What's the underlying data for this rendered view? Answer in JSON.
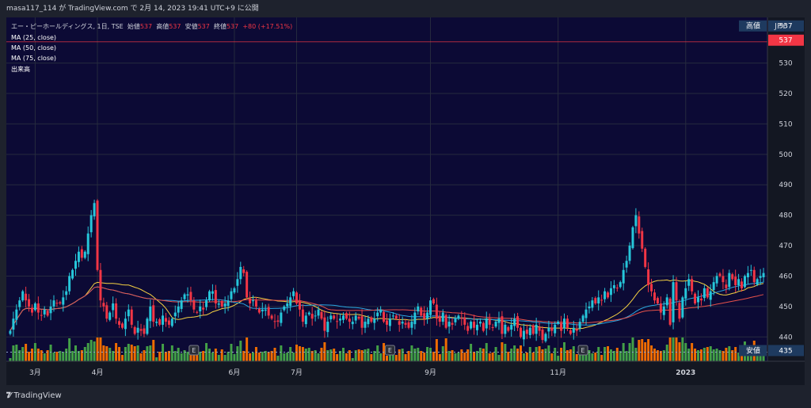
{
  "header": {
    "caption": "masa117_114 が TradingView.com で 2月 14, 2023 19:41 UTC+9 に公開"
  },
  "legend": {
    "symbol": "エー・ピーホールディングス, 1日, TSE",
    "open_label": "始値",
    "open_value": "537",
    "high_label": "高値",
    "high_value": "537",
    "low_label": "安値",
    "low_value": "537",
    "close_label": "終値",
    "close_value": "537",
    "change": "+80 (+17.51%)",
    "ma25": "MA (25, close)",
    "ma50": "MA (50, close)",
    "ma75": "MA (75, close)",
    "volume": "出来高"
  },
  "currency": "JPY",
  "footer": {
    "brand": "TradingView"
  },
  "colors": {
    "up": "#26c6da",
    "down": "#f23645",
    "vol_up": "#43a047",
    "vol_down": "#ef6c00",
    "ma25": "#f5d142",
    "ma50": "#2aa5e0",
    "ma75": "#e8524a",
    "plot_bg": "#0c0a35",
    "grid": "#262b3e"
  },
  "chart_data": {
    "type": "candlestick",
    "y_axis": {
      "min": 432,
      "max": 545,
      "ticks": [
        440,
        450,
        460,
        470,
        480,
        490,
        500,
        510,
        520,
        530
      ],
      "side": "right"
    },
    "x_labels": [
      {
        "label": "3月",
        "i": 8
      },
      {
        "label": "4月",
        "i": 28
      },
      {
        "label": "6月",
        "i": 72
      },
      {
        "label": "7月",
        "i": 92
      },
      {
        "label": "9月",
        "i": 135
      },
      {
        "label": "11月",
        "i": 176
      },
      {
        "label": "2023",
        "i": 217
      }
    ],
    "price_tags": [
      {
        "text": "高値",
        "value": "537",
        "color": "#1e3a5f"
      },
      {
        "value": "537",
        "color": "#f23645"
      },
      {
        "text": "安値",
        "value": "435",
        "color": "#1e3a5f"
      }
    ],
    "earnings_markers": [
      {
        "label": "E",
        "i": 59
      },
      {
        "label": "E",
        "i": 122
      },
      {
        "label": "E",
        "i": 184
      }
    ],
    "close": [
      442,
      446,
      449,
      452,
      455,
      452,
      450,
      448,
      451,
      448,
      447,
      449,
      447,
      450,
      452,
      451,
      451,
      453,
      455,
      460,
      462,
      465,
      468,
      466,
      468,
      474,
      480,
      484,
      462,
      452,
      450,
      446,
      448,
      451,
      446,
      444,
      443,
      446,
      449,
      444,
      441,
      443,
      442,
      441,
      446,
      450,
      445,
      445,
      444,
      447,
      445,
      444,
      446,
      448,
      450,
      452,
      454,
      454,
      452,
      449,
      448,
      450,
      449,
      452,
      455,
      455,
      451,
      451,
      450,
      451,
      452,
      455,
      456,
      459,
      463,
      461,
      453,
      451,
      452,
      450,
      448,
      449,
      449,
      447,
      446,
      445,
      445,
      448,
      450,
      451,
      453,
      455,
      451,
      449,
      445,
      447,
      448,
      446,
      447,
      449,
      446,
      442,
      445,
      447,
      446,
      445,
      446,
      447,
      446,
      445,
      445,
      447,
      446,
      443,
      445,
      446,
      445,
      446,
      448,
      449,
      445,
      444,
      446,
      447,
      446,
      444,
      445,
      444,
      443,
      445,
      448,
      450,
      447,
      446,
      448,
      452,
      451,
      446,
      445,
      448,
      443,
      445,
      444,
      446,
      447,
      446,
      444,
      442,
      445,
      443,
      444,
      445,
      442,
      446,
      444,
      443,
      445,
      446,
      441,
      444,
      442,
      444,
      446,
      443,
      440,
      442,
      441,
      443,
      441,
      444,
      442,
      439,
      441,
      443,
      442,
      444,
      445,
      442,
      446,
      443,
      441,
      443,
      442,
      445,
      447,
      449,
      450,
      452,
      451,
      453,
      452,
      455,
      453,
      456,
      457,
      456,
      458,
      462,
      465,
      470,
      476,
      480,
      474,
      469,
      463,
      457,
      455,
      452,
      451,
      448,
      450,
      453,
      444,
      458,
      452,
      446,
      453,
      456,
      459,
      455,
      451,
      453,
      452,
      456,
      453,
      455,
      458,
      460,
      460,
      458,
      456,
      461,
      459,
      457,
      459,
      456,
      460,
      461,
      462,
      458,
      459,
      460,
      461
    ]
  }
}
